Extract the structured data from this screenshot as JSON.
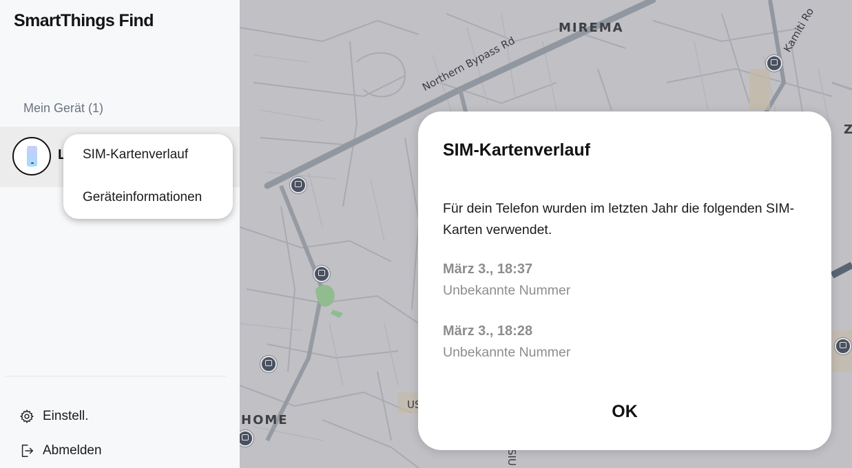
{
  "app": {
    "title": "SmartThings Find"
  },
  "sidebar": {
    "section_title": "Mein Gerät (1)",
    "device": {
      "name_initial": "L"
    },
    "context_menu": {
      "items": [
        {
          "label": "SIM-Kartenverlauf"
        },
        {
          "label": "Geräteinformationen"
        }
      ]
    },
    "bottom": {
      "settings": {
        "label": "Einstell.",
        "icon": "gear-icon"
      },
      "logout": {
        "label": "Abmelden",
        "icon": "logout-icon"
      }
    }
  },
  "map": {
    "labels": {
      "mirema": "MIREMA",
      "home": "HOME",
      "z": "Z"
    },
    "roads": {
      "northern_bypass": "Northern Bypass Rd",
      "kamiti": "Kamiti Ro",
      "us": "US",
      "siu": "SIU"
    }
  },
  "dialog": {
    "title": "SIM-Kartenverlauf",
    "message": "Für dein Telefon wurden im letzten Jahr die folgenden SIM-Karten verwendet.",
    "entries": [
      {
        "time": "März 3., 18:37",
        "number": "Unbekannte Nummer"
      },
      {
        "time": "März 3., 18:28",
        "number": "Unbekannte Nummer"
      }
    ],
    "ok_label": "OK"
  },
  "colors": {
    "map_background": "#d3d3d6",
    "sidebar_background": "#f7f8fa",
    "dialog_background": "#ffffff"
  }
}
